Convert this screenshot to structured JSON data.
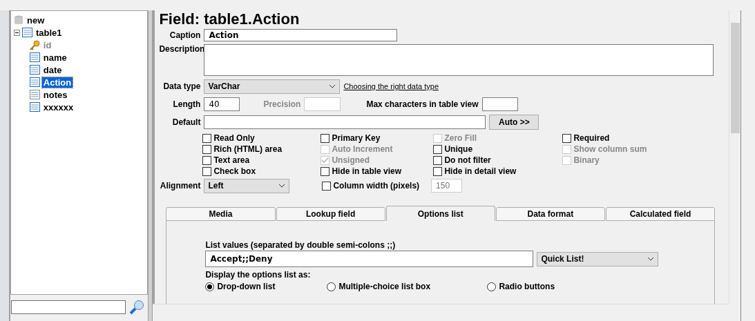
{
  "tree": {
    "label": "new",
    "children": [
      {
        "label": "table1",
        "expanded": true,
        "children": [
          {
            "label": "id",
            "kind": "key",
            "selected": false
          },
          {
            "label": "name",
            "kind": "field",
            "selected": false
          },
          {
            "label": "date",
            "kind": "field",
            "selected": false
          },
          {
            "label": "Action",
            "kind": "field",
            "selected": true
          },
          {
            "label": "notes",
            "kind": "memo",
            "selected": false
          },
          {
            "label": "xxxxxx",
            "kind": "field",
            "selected": false
          }
        ]
      }
    ]
  },
  "form": {
    "title": "Field: table1.Action",
    "caption": {
      "label": "Caption",
      "value": "Action"
    },
    "description": {
      "label": "Description"
    },
    "data_type": {
      "label": "Data type",
      "value": "VarChar",
      "link": "Choosing the right data type"
    },
    "length": {
      "label": "Length",
      "value": "40"
    },
    "precision": {
      "label": "Precision",
      "disabled": true
    },
    "max_chars": {
      "label": "Max characters in table view"
    },
    "default": {
      "label": "Default",
      "button": "Auto >>"
    },
    "checkbox_columns": [
      [
        {
          "label": "Read Only",
          "checked": false,
          "disabled": false
        },
        {
          "label": "Rich (HTML) area",
          "checked": false,
          "disabled": false
        },
        {
          "label": "Text area",
          "checked": false,
          "disabled": false
        },
        {
          "label": "Check box",
          "checked": false,
          "disabled": false
        }
      ],
      [
        {
          "label": "Primary Key",
          "checked": false,
          "disabled": false
        },
        {
          "label": "Auto Increment",
          "checked": false,
          "disabled": true
        },
        {
          "label": "Unsigned",
          "checked": true,
          "disabled": true
        },
        {
          "label": "Hide in table view",
          "checked": false,
          "disabled": false
        }
      ],
      [
        {
          "label": "Zero Fill",
          "checked": false,
          "disabled": true
        },
        {
          "label": "Unique",
          "checked": false,
          "disabled": false
        },
        {
          "label": "Do not filter",
          "checked": false,
          "disabled": false
        },
        {
          "label": "Hide in detail view",
          "checked": false,
          "disabled": false
        }
      ],
      [
        {
          "label": "Required",
          "checked": false,
          "disabled": false
        },
        {
          "label": "Show column sum",
          "checked": false,
          "disabled": true
        },
        {
          "label": "Binary",
          "checked": false,
          "disabled": true
        }
      ]
    ],
    "alignment": {
      "label": "Alignment",
      "value": "Left"
    },
    "column_width": {
      "label": "Column width (pixels)",
      "checked": false,
      "value": "150",
      "disabled": true
    }
  },
  "tabs": [
    {
      "label": "Media",
      "selected": false
    },
    {
      "label": "Lookup field",
      "selected": false
    },
    {
      "label": "Options list",
      "selected": true
    },
    {
      "label": "Data format",
      "selected": false
    },
    {
      "label": "Calculated field",
      "selected": false
    }
  ],
  "options": {
    "list_label": "List values (separated by double semi-colons ;;)",
    "list_value": "Accept;;Deny",
    "quick_list": "Quick List!",
    "display_label": "Display the options list as:",
    "radios": [
      {
        "label": "Drop-down list",
        "selected": true
      },
      {
        "label": "Multiple-choice list box",
        "selected": false
      },
      {
        "label": "Radio buttons",
        "selected": false
      }
    ]
  }
}
